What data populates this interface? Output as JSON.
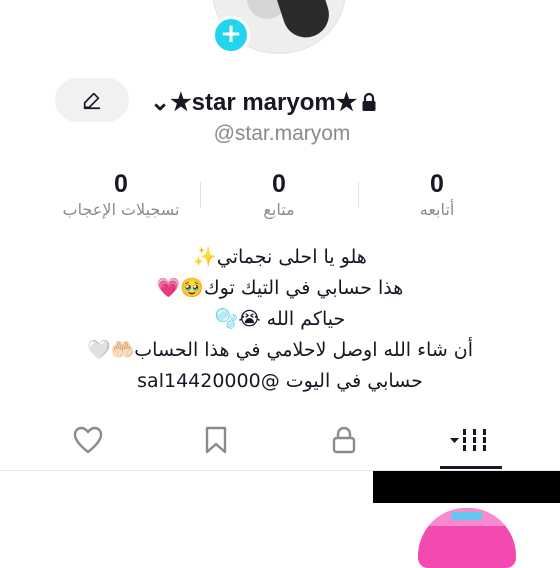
{
  "profile": {
    "display_name": "⌄★star maryom★",
    "handle": "@star.maryom"
  },
  "stats": [
    {
      "value": "0",
      "label": "أتابعه"
    },
    {
      "value": "0",
      "label": "متابع"
    },
    {
      "value": "0",
      "label": "تسجيلات الإعجاب"
    }
  ],
  "bio": [
    "هلو يا احلى نجماتي✨",
    "هذا حسابي في التيك توك🥹💗",
    "حياكم الله 😭🫧",
    "أن شاء الله اوصل لاحلامي في هذا الحساب🤲🏻🤍",
    "حسابي في اليوت @sal14420000"
  ],
  "tabs": [
    {
      "icon": "grid-icon",
      "active": true
    },
    {
      "icon": "lock-icon",
      "active": false
    },
    {
      "icon": "bookmark-icon",
      "active": false
    },
    {
      "icon": "heart-icon",
      "active": false
    }
  ],
  "colors": {
    "accent": "#20d5ec",
    "text": "#161823",
    "muted": "#8a8b91"
  }
}
